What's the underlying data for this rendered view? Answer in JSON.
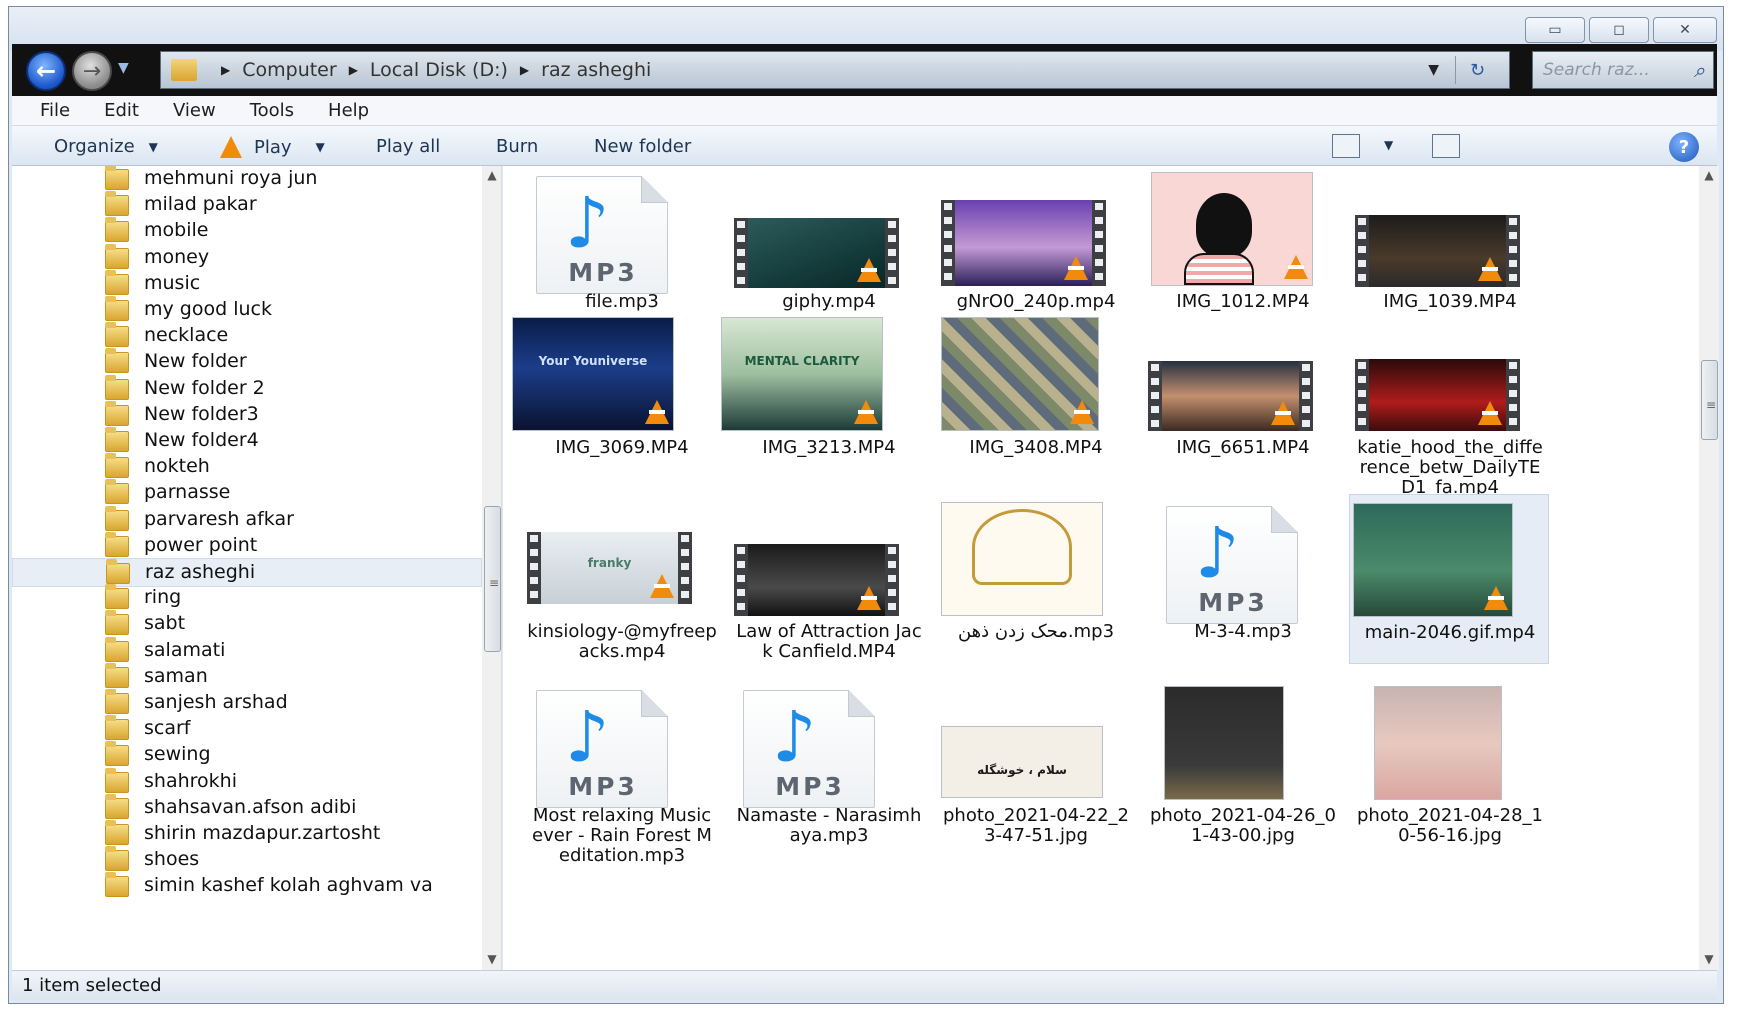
{
  "window": {
    "controls": {
      "minimize": "▭",
      "maximize": "◻",
      "close": "✕"
    }
  },
  "address": {
    "crumbs": [
      "Computer",
      "Local Disk (D:)",
      "raz asheghi"
    ],
    "search_placeholder": "Search raz..."
  },
  "menu": [
    "File",
    "Edit",
    "View",
    "Tools",
    "Help"
  ],
  "toolbar": {
    "organize": "Organize",
    "play": "Play",
    "play_all": "Play all",
    "burn": "Burn",
    "new_folder": "New folder",
    "help": "?"
  },
  "nav": {
    "items": [
      "mehmuni roya jun",
      "milad pakar",
      "mobile",
      "money",
      "music",
      "my good luck",
      "necklace",
      "New folder",
      "New folder 2",
      "New folder3",
      "New folder4",
      "nokteh",
      "parnasse",
      "parvaresh afkar",
      "power point",
      "raz asheghi",
      "ring",
      "sabt",
      "salamati",
      "saman",
      "sanjesh arshad",
      "scarf",
      "sewing",
      "shahrokhi",
      "shahsavan.afson adibi",
      "shirin mazdapur.zartosht",
      "shoes",
      "simin kashef kolah aghvam va"
    ],
    "selected": "raz asheghi"
  },
  "files": [
    {
      "name": "file.mp3",
      "type": "mp3"
    },
    {
      "name": "giphy.mp4",
      "type": "video"
    },
    {
      "name": "gNrO0_240p.mp4",
      "type": "video"
    },
    {
      "name": "IMG_1012.MP4",
      "type": "video"
    },
    {
      "name": "IMG_1039.MP4",
      "type": "video"
    },
    {
      "name": "IMG_3069.MP4",
      "type": "video",
      "thumb_text": [
        "Your Youniverse"
      ]
    },
    {
      "name": "IMG_3213.MP4",
      "type": "video",
      "thumb_text": [
        "MENTAL CLARITY"
      ]
    },
    {
      "name": "IMG_3408.MP4",
      "type": "video"
    },
    {
      "name": "IMG_6651.MP4",
      "type": "video"
    },
    {
      "name": "katie_hood_the_difference_betw_DailyTED1_fa.mp4",
      "type": "video"
    },
    {
      "name": "kinsiology-@myfreepacks.mp4",
      "type": "video",
      "thumb_text": [
        "franky"
      ]
    },
    {
      "name": "Law of Attraction Jack Canfield.MP4",
      "type": "video"
    },
    {
      "name": "محک زدن ذهن.mp3",
      "type": "image"
    },
    {
      "name": "M-3-4.mp3",
      "type": "mp3"
    },
    {
      "name": "main-2046.gif.mp4",
      "type": "video",
      "selected": true
    },
    {
      "name": "Most relaxing Music ever - Rain Forest Meditation.mp3",
      "type": "mp3"
    },
    {
      "name": "Namaste - Narasimhaya.mp3",
      "type": "mp3"
    },
    {
      "name": "photo_2021-04-22_23-47-51.jpg",
      "type": "image",
      "thumb_text": [
        "سلام ، خوشگله"
      ]
    },
    {
      "name": "photo_2021-04-26_01-43-00.jpg",
      "type": "image"
    },
    {
      "name": "photo_2021-04-28_10-56-16.jpg",
      "type": "image"
    }
  ],
  "mp3_label": "MP3",
  "status": {
    "text": "1 item selected"
  }
}
